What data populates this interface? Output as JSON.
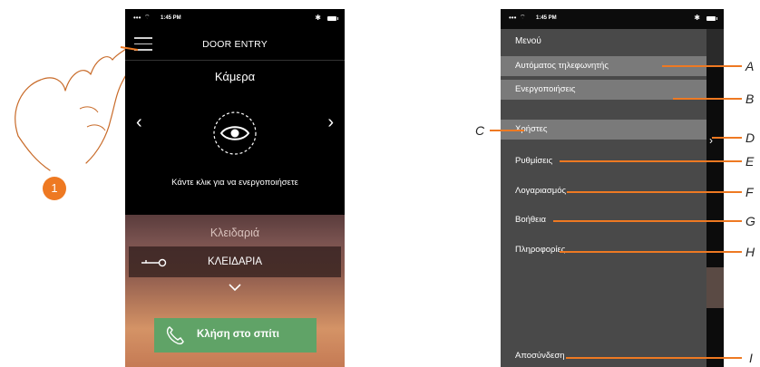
{
  "left_screen": {
    "status": {
      "signal": "•••",
      "time": "1:45 PM"
    },
    "header_title": "DOOR ENTRY",
    "camera_title": "Κάμερα",
    "camera_hint": "Κάντε κλικ για να ενεργοποιήσετε",
    "lock_section_title": "Κλειδαριά",
    "lock_button_label": "ΚΛΕΙΔΑΡΙΑ",
    "call_button_label": "Κλήση στο σπίτι",
    "callout_number": "1"
  },
  "right_screen": {
    "status": {
      "signal": "•••",
      "time": "1:45 PM"
    },
    "menu_heading": "Μενού",
    "menu_items": [
      {
        "label": "Αυτόματος τηλεφωνητής",
        "callout": "A"
      },
      {
        "label": "Ενεργοποιήσεις",
        "callout": "B"
      },
      {
        "label": "Χρήστες",
        "callout": "C"
      },
      {
        "label": "Ρυθμίσεις",
        "callout": "E"
      },
      {
        "label": "Λογαριασμός",
        "callout": "F"
      },
      {
        "label": "Βοήθεια",
        "callout": "G"
      },
      {
        "label": "Πληροφορίες",
        "callout": "H"
      },
      {
        "label": "Αποσύνδεση",
        "callout": "I"
      }
    ],
    "arrow_callout": "D"
  },
  "colors": {
    "callout_orange": "#ee7922",
    "call_button_green": "#60a367",
    "menu_panel": "#494949",
    "menu_highlight": "#7a7a7a"
  }
}
